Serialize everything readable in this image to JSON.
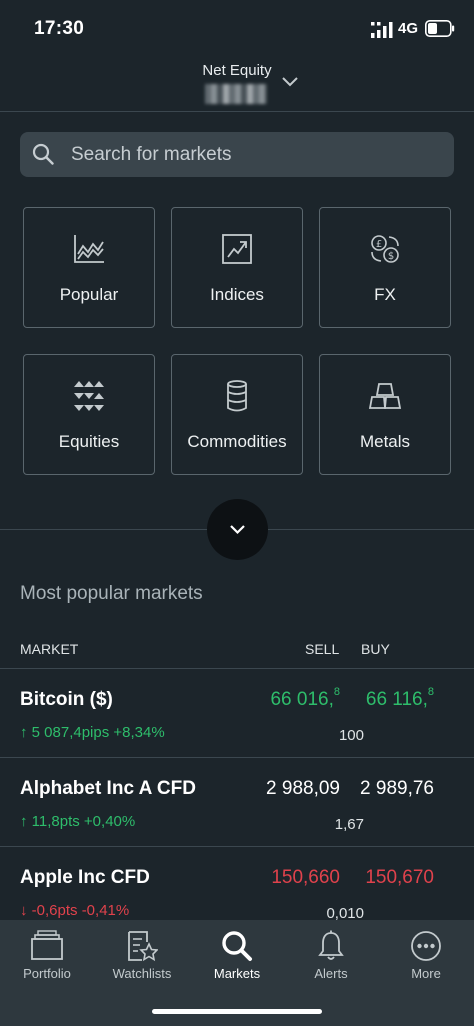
{
  "status_bar": {
    "time": "17:30",
    "network": "4G",
    "icons": [
      "signal-icon",
      "battery-icon"
    ]
  },
  "header": {
    "title": "Net Equity",
    "icons": [
      "chevron-down-icon"
    ]
  },
  "search": {
    "placeholder": "Search for markets",
    "icon": "search-icon"
  },
  "categories": [
    {
      "label": "Popular",
      "icon": "line-chart-icon"
    },
    {
      "label": "Indices",
      "icon": "trend-up-icon"
    },
    {
      "label": "FX",
      "icon": "currency-exchange-icon"
    },
    {
      "label": "Equities",
      "icon": "up-down-arrows-icon"
    },
    {
      "label": "Commodities",
      "icon": "barrel-icon"
    },
    {
      "label": "Metals",
      "icon": "gold-bars-icon"
    }
  ],
  "section_title": "Most popular markets",
  "table": {
    "headers": {
      "market": "MARKET",
      "sell": "SELL",
      "buy": "BUY"
    },
    "rows": [
      {
        "name": "Bitcoin ($)",
        "change": "↑ 5 087,4pips +8,34%",
        "direction": "up",
        "sell_main": "66 016,",
        "sell_sup": "8",
        "buy_main": "66 116,",
        "buy_sup": "8",
        "spread": "100"
      },
      {
        "name": "Alphabet Inc A CFD",
        "change": "↑ 11,8pts +0,40%",
        "direction": "up",
        "sell_main": "2 988,09",
        "sell_sup": "",
        "buy_main": "2 989,76",
        "buy_sup": "",
        "spread": "1,67"
      },
      {
        "name": "Apple Inc CFD",
        "change": "↓ -0,6pts -0,41%",
        "direction": "down",
        "sell_main": "150,660",
        "sell_sup": "",
        "buy_main": "150,670",
        "buy_sup": "",
        "spread": "0,010"
      }
    ]
  },
  "bottom_nav": [
    {
      "label": "Portfolio",
      "icon": "portfolio-icon"
    },
    {
      "label": "Watchlists",
      "icon": "watchlist-icon"
    },
    {
      "label": "Markets",
      "icon": "search-icon",
      "active": true
    },
    {
      "label": "Alerts",
      "icon": "bell-icon"
    },
    {
      "label": "More",
      "icon": "more-icon"
    }
  ],
  "colors": {
    "background": "#1c252b",
    "positive": "#2ebd6b",
    "negative": "#e0424c",
    "nav_background": "#2e383e"
  }
}
